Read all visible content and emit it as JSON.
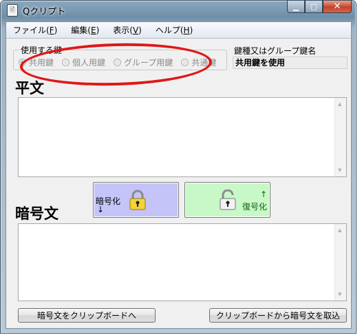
{
  "window": {
    "title": "Qクリプト",
    "app_icon_glyph": "🖹",
    "minimize_glyph": "▁",
    "maximize_glyph": "▢",
    "close_glyph": "✕"
  },
  "menu": [
    {
      "label": "ファイル(",
      "key": "F",
      "tail": ")"
    },
    {
      "label": "編集(",
      "key": "E",
      "tail": ")"
    },
    {
      "label": "表示(",
      "key": "V",
      "tail": ")"
    },
    {
      "label": "ヘルプ(",
      "key": "H",
      "tail": ")"
    }
  ],
  "key_select": {
    "legend": "使用する鍵",
    "options": [
      {
        "label": "共用鍵",
        "selected": true
      },
      {
        "label": "個人用鍵",
        "selected": false
      },
      {
        "label": "グループ用鍵",
        "selected": false
      },
      {
        "label": "共通鍵",
        "selected": false
      }
    ]
  },
  "key_name": {
    "label": "鍵種又はグループ鍵名",
    "value": "共用鍵を使用"
  },
  "plaintext": {
    "label": "平文",
    "value": ""
  },
  "ciphertext": {
    "label": "暗号文",
    "value": ""
  },
  "encrypt_button": {
    "label": "暗号化",
    "arrow": "↓",
    "color": "#c4c4f8"
  },
  "decrypt_button": {
    "label": "復号化",
    "arrow": "↑",
    "color": "#c8f8c8"
  },
  "copy_button": {
    "label": "暗号文をクリップボードへ"
  },
  "paste_button": {
    "label": "クリップボードから暗号文を取込"
  },
  "annotation": {
    "color": "#e01818"
  }
}
